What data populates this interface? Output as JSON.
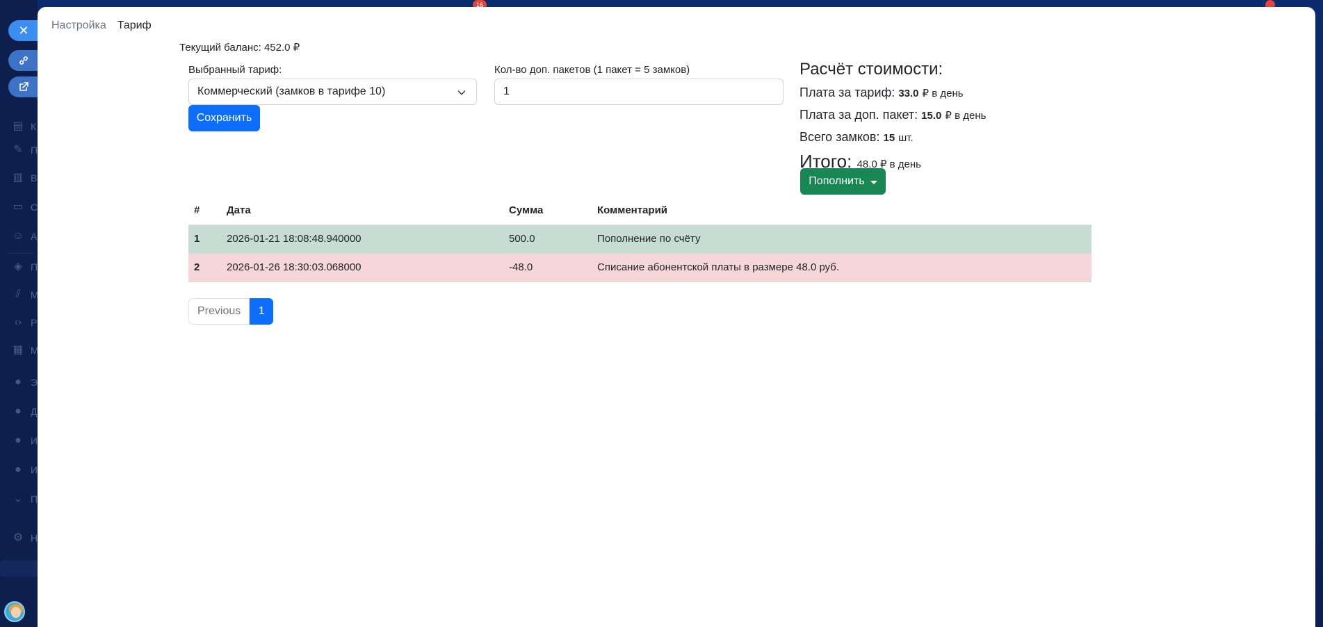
{
  "background": {
    "badge_count": "16",
    "sidebar_items": [
      "К",
      "П",
      "В",
      "С",
      "А",
      "П",
      "М",
      "Р",
      "М",
      "Э",
      "Д",
      "И",
      "И",
      "П",
      "Н"
    ]
  },
  "breadcrumb": {
    "settings": "Настройка",
    "tariff": "Тариф"
  },
  "balance": "Текущий баланс: 452.0 ₽",
  "form": {
    "tariff_label": "Выбранный тариф:",
    "tariff_value": "Коммерческий (замков в тарифе 10)",
    "packages_label": "Кол-во доп. пакетов (1 пакет = 5 замков)",
    "packages_value": "1",
    "save_label": "Сохранить"
  },
  "calc": {
    "title": "Расчёт стоимости:",
    "tariff_fee_label": "Плата за тариф:",
    "tariff_fee_value": "33.0",
    "tariff_fee_unit": "₽ в день",
    "pkg_fee_label": "Плата за доп. пакет:",
    "pkg_fee_value": "15.0",
    "pkg_fee_unit": "₽ в день",
    "locks_label": "Всего замков:",
    "locks_value": "15",
    "locks_unit": "шт.",
    "total_label": "Итого:",
    "total_value": "48.0 ₽ в день",
    "topup_label": "Пополнить"
  },
  "table": {
    "headers": [
      "#",
      "Дата",
      "Сумма",
      "Комментарий"
    ],
    "rows": [
      {
        "num": "1",
        "date": "2026-01-21 18:08:48.940000",
        "amount": "500.0",
        "comment": "Пополнение по счёту"
      },
      {
        "num": "2",
        "date": "2026-01-26 18:30:03.068000",
        "amount": "-48.0",
        "comment": "Списание абонентской платы в размере 48.0 руб."
      }
    ]
  },
  "pagination": {
    "prev": "Previous",
    "current": "1"
  },
  "colors": {
    "primary": "#0d6efd",
    "success": "#198754",
    "row_success": "#c7ddd4",
    "row_danger": "#f7d6da"
  }
}
